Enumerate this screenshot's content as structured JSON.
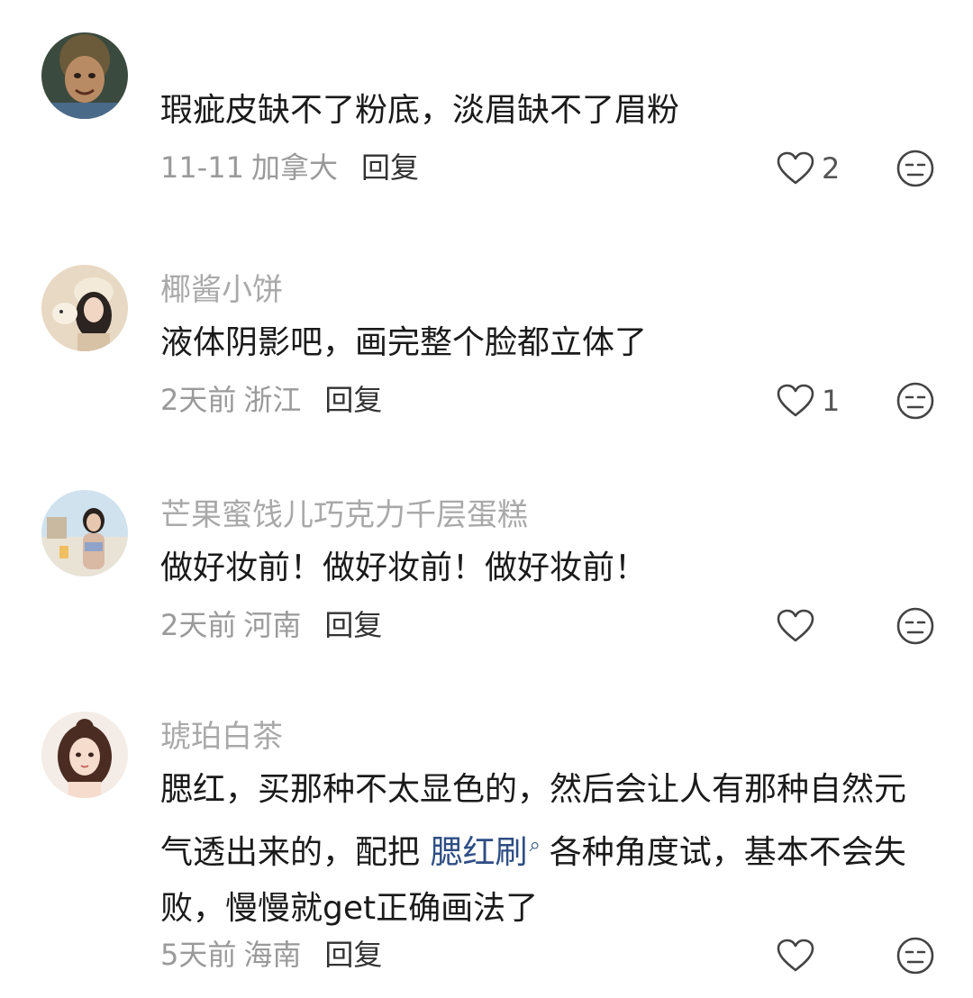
{
  "comments": [
    {
      "username": "",
      "text": "瑕疵皮缺不了粉底，淡眉缺不了眉粉",
      "date": "11-11",
      "region": "加拿大",
      "reply_label": "回复",
      "like_count": "2"
    },
    {
      "username": "椰酱小饼",
      "text": "液体阴影吧，画完整个脸都立体了",
      "date": "2天前",
      "region": "浙江",
      "reply_label": "回复",
      "like_count": "1"
    },
    {
      "username": "芒果蜜饯儿巧克力千层蛋糕",
      "text": "做好妆前！做好妆前！做好妆前！",
      "date": "2天前",
      "region": "河南",
      "reply_label": "回复",
      "like_count": ""
    },
    {
      "username": "琥珀白茶",
      "text_before": "腮红，买那种不太显色的，然后会让人有那种自然元气透出来的，配把 ",
      "link_text": "腮红刷",
      "text_after": "各种角度试，基本不会失败，慢慢就get正确画法了",
      "date": "5天前",
      "region": "海南",
      "reply_label": "回复",
      "like_count": ""
    }
  ],
  "icons": {
    "like": "heart-outline-icon",
    "emoji": "neutral-face-icon",
    "link": "search-icon"
  },
  "colors": {
    "username": "#a9a9a9",
    "text": "#1a1a1a",
    "meta": "#9a9a9a",
    "reply": "#333333",
    "link": "#2e4e84"
  }
}
